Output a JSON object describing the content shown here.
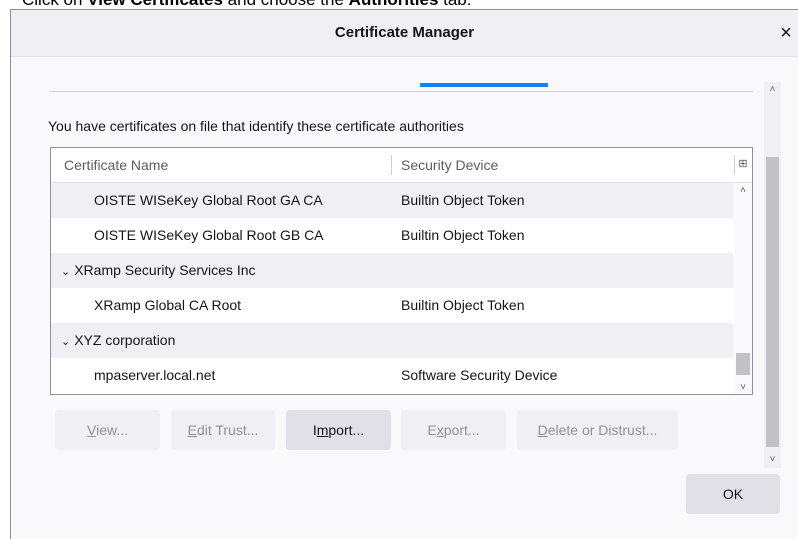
{
  "caption": {
    "prefix": "Click on ",
    "bold1": "View Certificates",
    "middle": " and choose the ",
    "bold2": "Authorities",
    "suffix": " tab:"
  },
  "dialog": {
    "title": "Certificate Manager",
    "close_glyph": "×"
  },
  "intro_text": "You have certificates on file that identify these certificate authorities",
  "table": {
    "columns": [
      "Certificate Name",
      "Security Device"
    ],
    "column_picker_glyph": "⊞",
    "rows": [
      {
        "type": "child",
        "name": "OISTE WISeKey Global Root GA CA",
        "device": "Builtin Object Token"
      },
      {
        "type": "child",
        "name": "OISTE WISeKey Global Root GB CA",
        "device": "Builtin Object Token"
      },
      {
        "type": "group",
        "twisty": "⌄",
        "name": "XRamp Security Services Inc",
        "device": ""
      },
      {
        "type": "child",
        "name": "XRamp Global CA Root",
        "device": "Builtin Object Token"
      },
      {
        "type": "group",
        "twisty": "⌄",
        "name": "XYZ corporation",
        "device": ""
      },
      {
        "type": "child",
        "name": "mpaserver.local.net",
        "device": "Software Security Device"
      }
    ],
    "scroll_up_glyph": "˄",
    "scroll_down_glyph": "˅"
  },
  "buttons": {
    "view": {
      "mnemonic": "V",
      "rest": "iew..."
    },
    "edit_trust": {
      "mnemonic": "E",
      "rest": "dit Trust..."
    },
    "import": {
      "before": "I",
      "mnemonic": "m",
      "rest": "port..."
    },
    "export": {
      "before": "E",
      "mnemonic": "x",
      "rest": "port..."
    },
    "delete": {
      "mnemonic": "D",
      "rest": "elete or Distrust..."
    },
    "ok": "OK"
  },
  "colors": {
    "accent": "#0a84ff",
    "dialog_bg": "#f9f9fb",
    "row_alt": "#f0f0f4"
  }
}
